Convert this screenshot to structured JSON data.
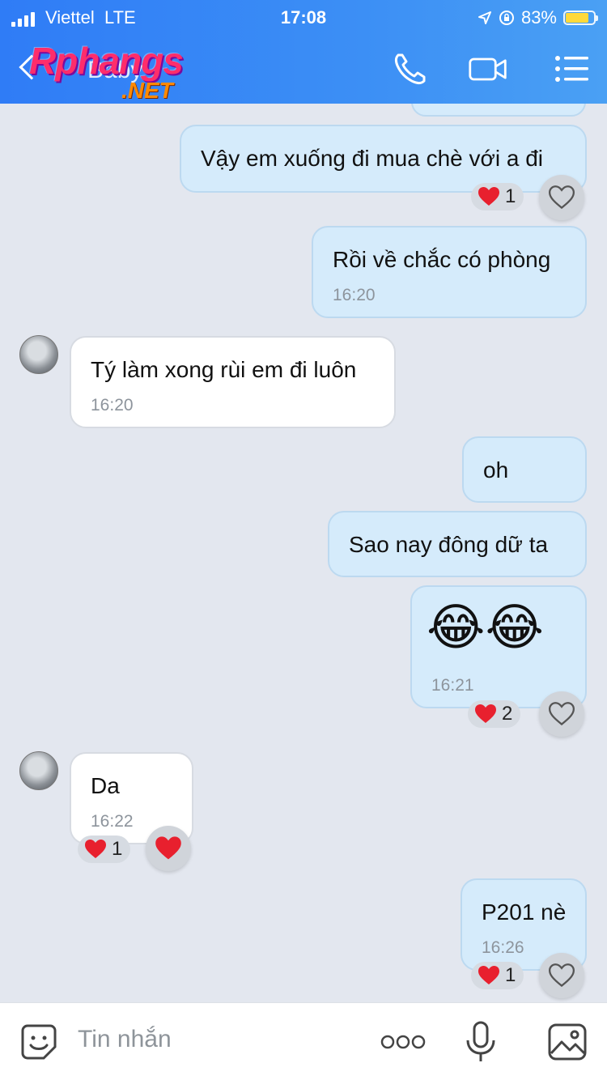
{
  "status_bar": {
    "carrier": "Viettel",
    "network": "LTE",
    "time": "17:08",
    "battery": "83%",
    "battery_level": 0.83
  },
  "header": {
    "title": "Baby",
    "watermark_main": "Rphangs",
    "watermark_sub": ".NET"
  },
  "messages": [
    {
      "dir": "out",
      "text": "Vậy em xuống đi mua chè với a đi",
      "reaction_count": "1"
    },
    {
      "dir": "out",
      "text": "Rồi về chắc có phòng",
      "time": "16:20"
    },
    {
      "dir": "in",
      "text": "Tý làm xong rùi em đi luôn",
      "time": "16:20"
    },
    {
      "dir": "out",
      "text": "oh"
    },
    {
      "dir": "out",
      "text": "Sao nay đông dữ ta"
    },
    {
      "dir": "out",
      "text": "😂😂",
      "time": "16:21",
      "reaction_count": "2"
    },
    {
      "dir": "in",
      "text": "Da",
      "time": "16:22",
      "reaction_count": "1"
    },
    {
      "dir": "out",
      "text": "P201 nè",
      "time": "16:26",
      "reaction_count": "1"
    }
  ],
  "composer": {
    "placeholder": "Tin nhắn"
  },
  "colors": {
    "header": "#3c8ff5",
    "out_bubble": "#d5ebfb",
    "in_bubble": "#ffffff",
    "background": "#e3e7ef",
    "heart": "#e8202e"
  }
}
